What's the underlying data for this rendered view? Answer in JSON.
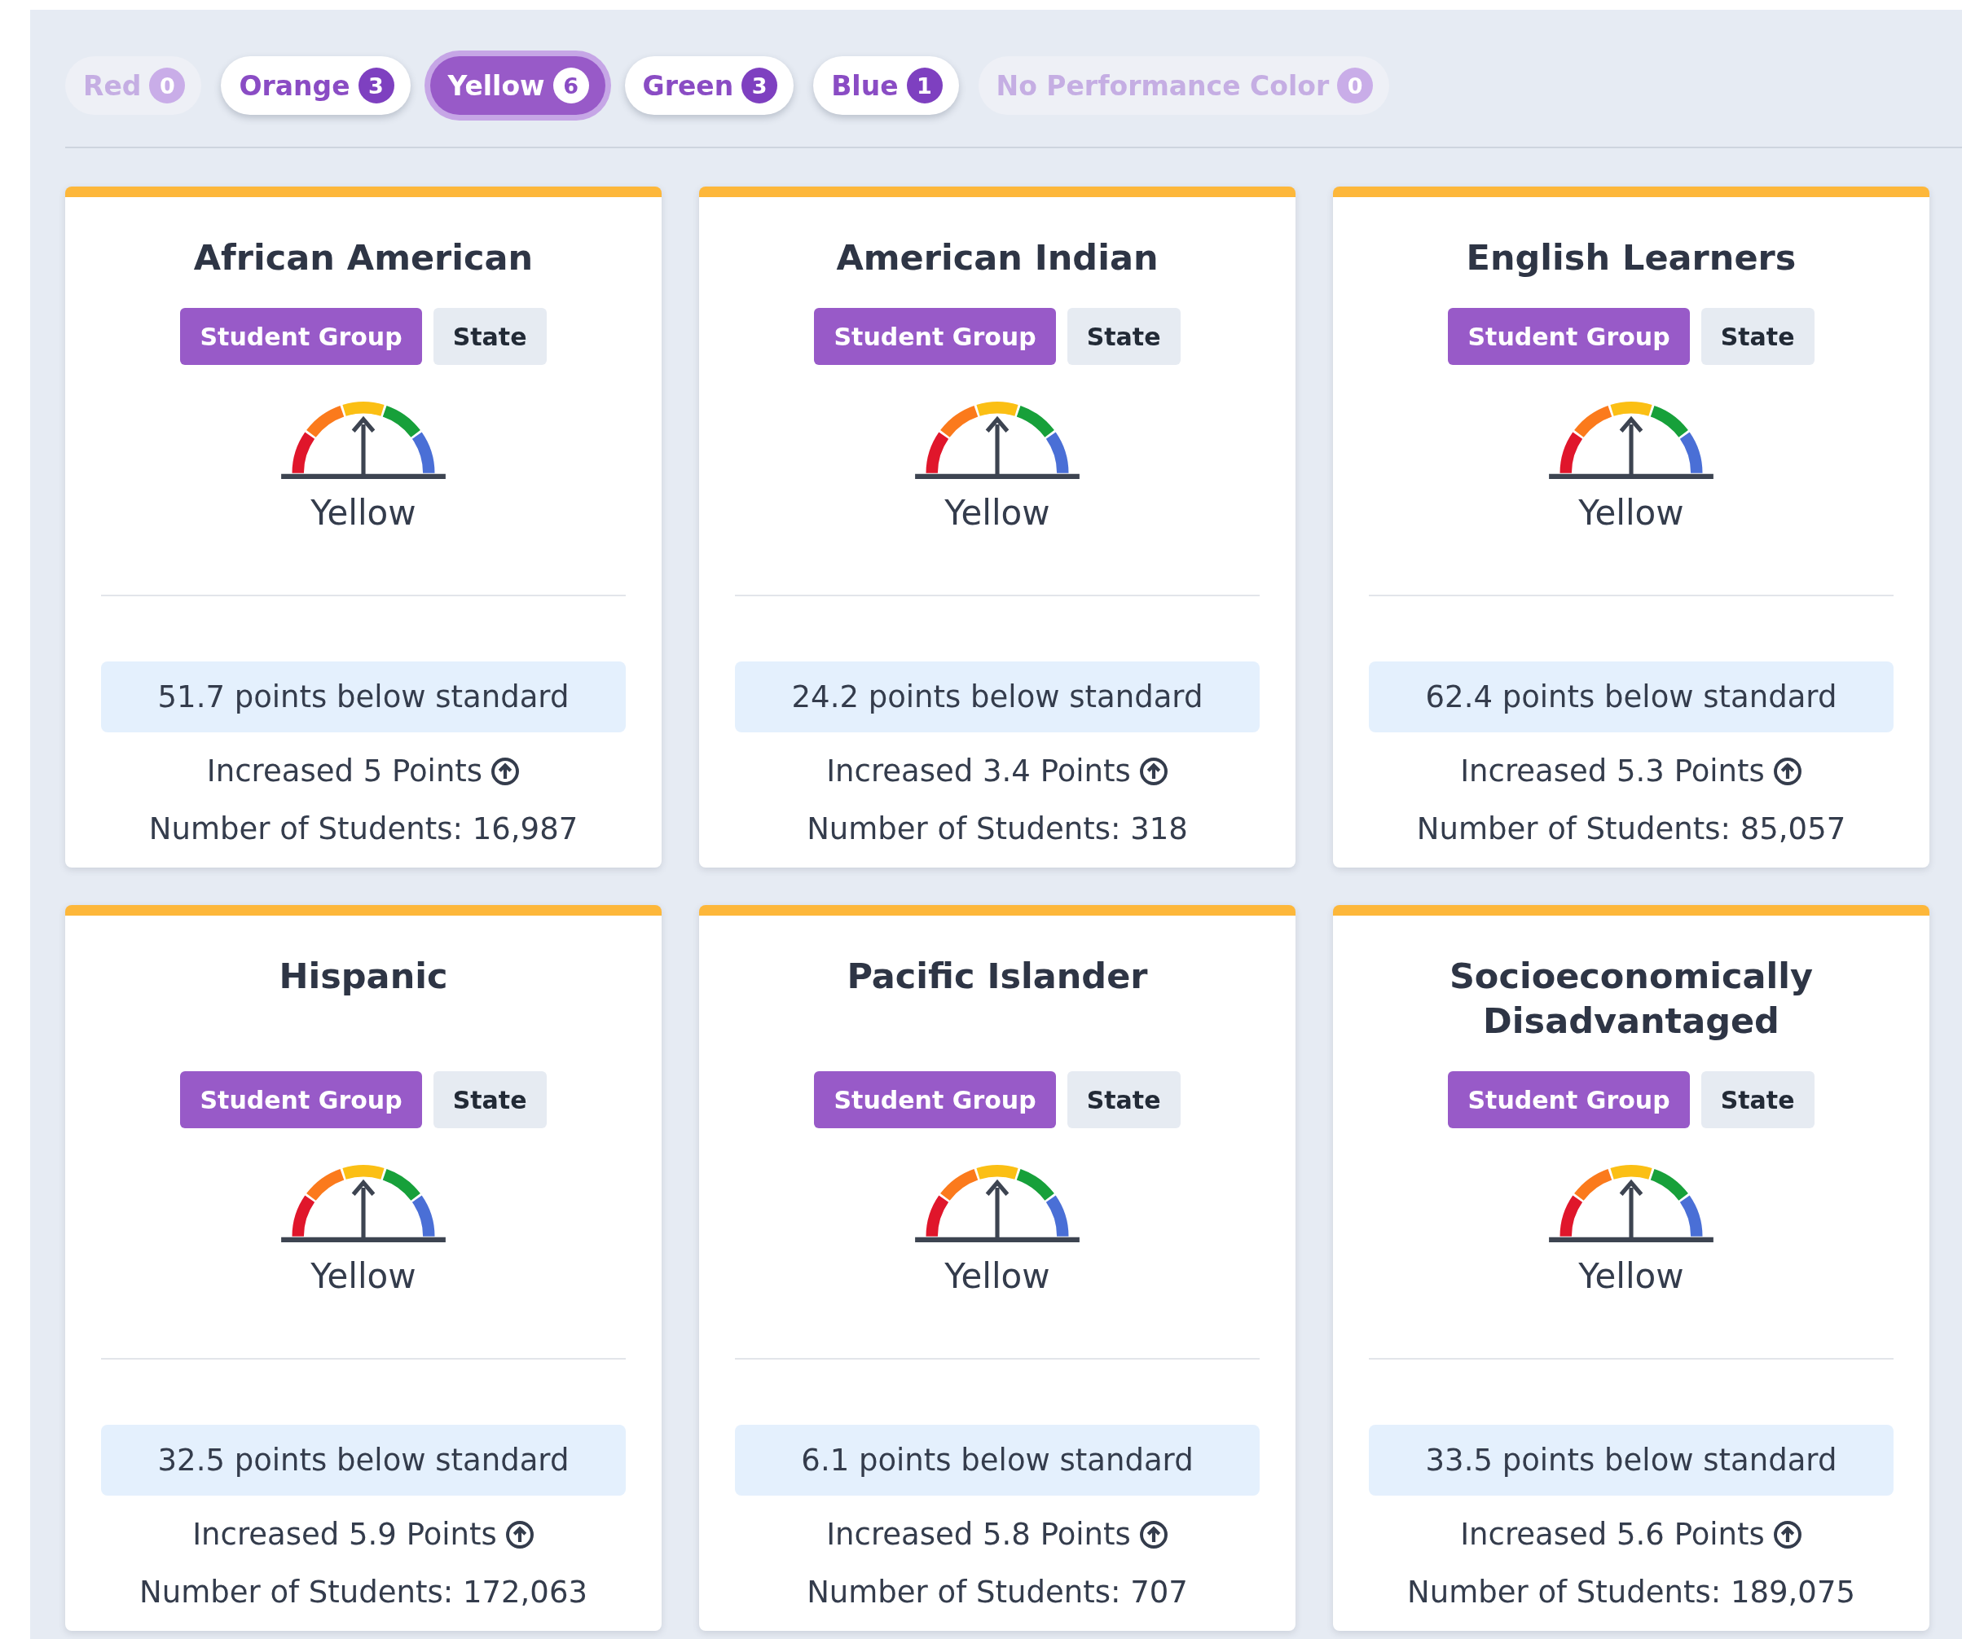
{
  "filters": [
    {
      "label": "Red",
      "count": "0",
      "selected": false,
      "disabled": true
    },
    {
      "label": "Orange",
      "count": "3",
      "selected": false,
      "disabled": false
    },
    {
      "label": "Yellow",
      "count": "6",
      "selected": true,
      "disabled": false
    },
    {
      "label": "Green",
      "count": "3",
      "selected": false,
      "disabled": false
    },
    {
      "label": "Blue",
      "count": "1",
      "selected": false,
      "disabled": false
    },
    {
      "label": "No Performance Color",
      "count": "0",
      "selected": false,
      "disabled": true
    }
  ],
  "cards": [
    {
      "title": "African American",
      "toggles": [
        {
          "label": "Student Group",
          "selected": true
        },
        {
          "label": "State",
          "selected": false
        }
      ],
      "performance": "Yellow",
      "status": "51.7 points below standard",
      "change": "Increased 5 Points",
      "students": "Number of Students: 16,987"
    },
    {
      "title": "American Indian",
      "toggles": [
        {
          "label": "Student Group",
          "selected": true
        },
        {
          "label": "State",
          "selected": false
        }
      ],
      "performance": "Yellow",
      "status": "24.2 points below standard",
      "change": "Increased 3.4 Points",
      "students": "Number of Students: 318"
    },
    {
      "title": "English Learners",
      "toggles": [
        {
          "label": "Student Group",
          "selected": true
        },
        {
          "label": "State",
          "selected": false
        }
      ],
      "performance": "Yellow",
      "status": "62.4 points below standard",
      "change": "Increased 5.3 Points",
      "students": "Number of Students: 85,057"
    },
    {
      "title": "Hispanic",
      "toggles": [
        {
          "label": "Student Group",
          "selected": true
        },
        {
          "label": "State",
          "selected": false
        }
      ],
      "performance": "Yellow",
      "status": "32.5 points below standard",
      "change": "Increased 5.9 Points",
      "students": "Number of Students: 172,063"
    },
    {
      "title": "Pacific Islander",
      "toggles": [
        {
          "label": "Student Group",
          "selected": true
        },
        {
          "label": "State",
          "selected": false
        }
      ],
      "performance": "Yellow",
      "status": "6.1 points below standard",
      "change": "Increased 5.8 Points",
      "students": "Number of Students: 707"
    },
    {
      "title": "Socioeconomically Disadvantaged",
      "toggles": [
        {
          "label": "Student Group",
          "selected": true
        },
        {
          "label": "State",
          "selected": false
        }
      ],
      "performance": "Yellow",
      "status": "33.5 points below standard",
      "change": "Increased 5.6 Points",
      "students": "Number of Students: 189,075"
    }
  ]
}
